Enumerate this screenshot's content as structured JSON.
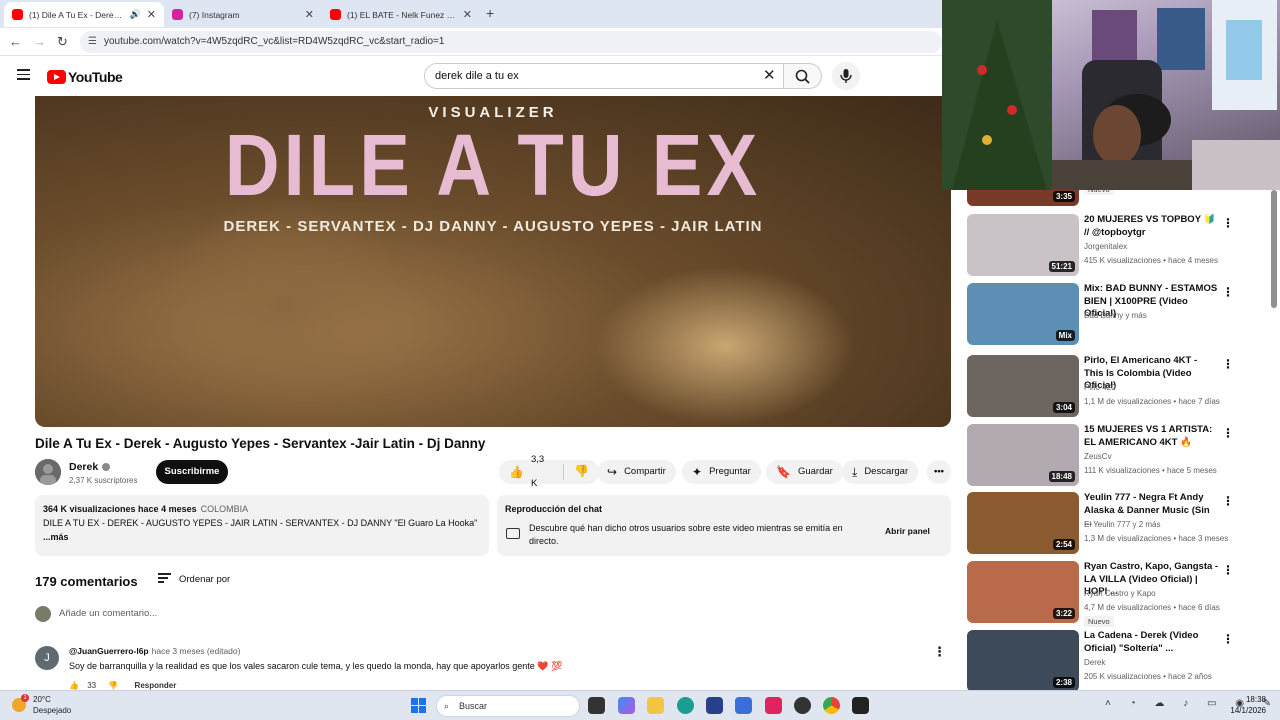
{
  "browser": {
    "tabs": [
      {
        "title": "(1) Dile A Tu Ex - Derek - Au",
        "active": true,
        "favicon_color": "#ff0000"
      },
      {
        "title": "(7) Instagram",
        "active": false,
        "favicon_color": "#d6249f"
      },
      {
        "title": "(1) EL BATE - Nelk Funez FT @ja",
        "active": false,
        "favicon_color": "#ff0000"
      }
    ],
    "url": "youtube.com/watch?v=4W5zqdRC_vc&list=RD4W5zqdRC_vc&start_radio=1"
  },
  "yt": {
    "logo": "YouTube",
    "search_query": "derek dile a tu ex"
  },
  "video": {
    "overlay_top": "VISUALIZER",
    "overlay_title": "DILE A TU EX",
    "overlay_sub": "DEREK - SERVANTEX - DJ DANNY - AUGUSTO YEPES - JAIR LATIN",
    "title": "Dile A Tu Ex - Derek - Augusto Yepes - Servantex -Jair Latin - Dj Danny",
    "channel": "Derek",
    "subs": "2,37 K suscriptores",
    "subscribe": "Suscribirme",
    "likes": "3,3 K",
    "share": "Compartir",
    "ask": "Preguntar",
    "save": "Guardar",
    "download": "Descargar"
  },
  "description": {
    "meta": "364 K visualizaciones  hace 4 meses",
    "country": "COLOMBIA",
    "line": "DILE A TU EX -  DEREK - AUGUSTO YEPES - JAIR LATIN - SERVANTEX - DJ DANNY \"El Guaro La Hooka\"",
    "more": "...más"
  },
  "chat": {
    "heading": "Reproducción del chat",
    "text": "Descubre qué han dicho otros usuarios sobre este video mientras se emitía en directo.",
    "open": "Abrir panel"
  },
  "comments": {
    "count": "179 comentarios",
    "sort": "Ordenar por",
    "add_placeholder": "Añade un comentario...",
    "first": {
      "avatar": "J",
      "user": "@JuanGuerrero-l6p",
      "when": "hace 3 meses (editado)",
      "text": "Soy de barranquilla y la realidad es que los vales sacaron cule tema, y les quedo la monda, hay que apoyarlos gente ❤️ 💯",
      "likes": "33",
      "reply": "Responder"
    }
  },
  "sidebar": {
    "top_partial": {
      "dur": "3:35",
      "badge": "Nuevo"
    },
    "items": [
      {
        "title": "20 MUJERES VS TOPBOY 🔰 // @topboytgr",
        "channel": "Jorgenitalex",
        "views": "415 K visualizaciones • hace 4 meses",
        "dur": "51:21",
        "badge": "",
        "thumb": "#c9c2c6"
      },
      {
        "title": "Mix: BAD BUNNY - ESTAMOS BIEN | X100PRE (Video Oficial)",
        "channel": "Bad Bunny y más",
        "views": "",
        "dur": "Mix",
        "badge": "",
        "thumb": "#5d8fb4"
      },
      {
        "title": "Pirlo, El Americano 4KT - This Is Colombia (Video Oficial)",
        "channel": "Pirlo 420",
        "views": "1,1 M de visualizaciones • hace 7 días",
        "dur": "3:04",
        "badge": "",
        "thumb": "#6d6560"
      },
      {
        "title": "15 MUJERES VS 1 ARTISTA: EL AMERICANO 4KT 🔥",
        "channel": "ZeusCv",
        "views": "111 K visualizaciones • hace 5 meses",
        "dur": "18:48",
        "badge": "",
        "thumb": "#b3a9b0"
      },
      {
        "title": "Yeulin 777 - Negra Ft Andy Alaska & Danner Music (Sin ...",
        "channel": "El Yeulin 777 y 2 más",
        "views": "1,3 M de visualizaciones • hace 3 meses",
        "dur": "2:54",
        "badge": "",
        "thumb": "#8a5a30"
      },
      {
        "title": "Ryan Castro, Kapo, Gangsta - LA VILLA (Video Oficial) | HOPI ...",
        "channel": "Ryan Castro y Kapo",
        "views": "4,7 M de visualizaciones • hace 6 días",
        "dur": "3:22",
        "badge": "Nuevo",
        "thumb": "#b86a4a"
      },
      {
        "title": "La Cadena - Derek (Video Oficial) \"Soltería\" ...",
        "channel": "Derek",
        "views": "205 K visualizaciones • hace 2 años",
        "dur": "2:38",
        "badge": "",
        "thumb": "#3c4a5a"
      }
    ]
  },
  "taskbar": {
    "temp": "20°C",
    "weather": "Despejado",
    "weather_badge": "1",
    "search": "Buscar",
    "time": "18:38",
    "date": "14/1/2026"
  }
}
